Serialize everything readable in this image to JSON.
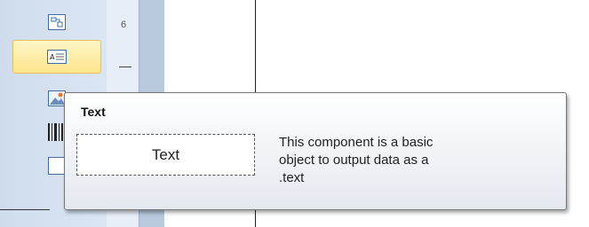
{
  "ruler": {
    "number": "6"
  },
  "toolbar": {
    "items": [
      {
        "icon": "subreport-icon"
      },
      {
        "icon": "text-icon",
        "selected": true
      },
      {
        "icon": "image-icon"
      },
      {
        "icon": "barcode-icon"
      },
      {
        "icon": "panel-icon"
      }
    ]
  },
  "tooltip": {
    "title": "Text",
    "preview_text": "Text",
    "description": "This component is a basic\n object to output data as a\n.text"
  },
  "colors": {
    "selected_bg": "#fde58d",
    "toolbar_bg": "#dbe6f3"
  }
}
